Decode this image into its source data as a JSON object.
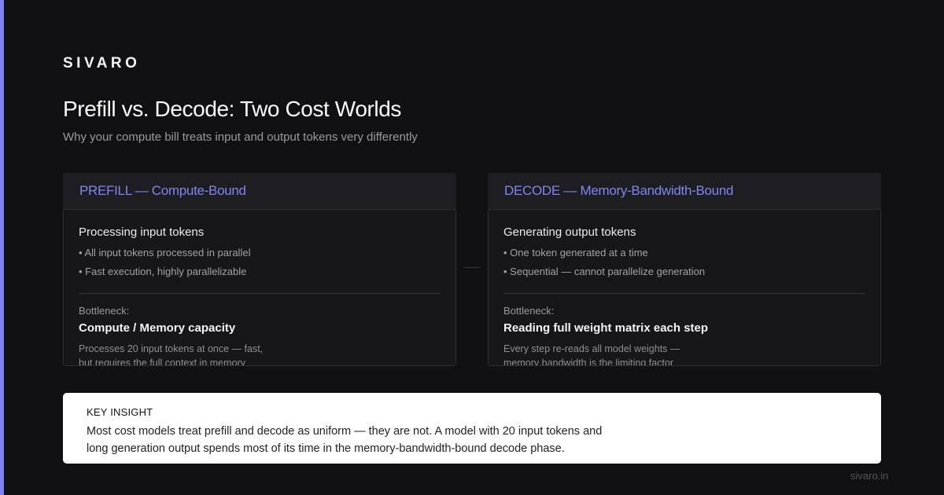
{
  "brand": "SIVARO",
  "header": {
    "title": "Prefill vs. Decode: Two Cost Worlds",
    "subtitle": "Why your compute bill treats input and output tokens very differently"
  },
  "panels": [
    {
      "heading": "PREFILL — Compute-Bound",
      "body_title": "Processing input tokens",
      "bullets": [
        "• All input tokens processed in parallel",
        "• Fast execution, highly parallelizable"
      ],
      "bottleneck_label": "Bottleneck:",
      "bottleneck_value": "Compute / Memory capacity",
      "note_lines": [
        "Processes 20 input tokens at once — fast,",
        "but requires the full context in memory"
      ]
    },
    {
      "heading": "DECODE — Memory-Bandwidth-Bound",
      "body_title": "Generating output tokens",
      "bullets": [
        "• One token generated at a time",
        "• Sequential — cannot parallelize generation"
      ],
      "bottleneck_label": "Bottleneck:",
      "bottleneck_value": "Reading full weight matrix each step",
      "note_lines": [
        "Every step re-reads all model weights —",
        "memory bandwidth is the limiting factor"
      ]
    }
  ],
  "insight": {
    "label": "KEY INSIGHT",
    "text_lines": [
      "Most cost models treat prefill and decode as uniform — they are not. A model with 20 input tokens and",
      "long generation output spends most of its time in the memory-bandwidth-bound decode phase."
    ]
  },
  "footer": {
    "url": "sivaro.in"
  },
  "colors": {
    "background": "#111113",
    "accent": "#7b82f0",
    "panel_heading": "#7f86f2",
    "panel_body": "#17171a",
    "insight_bg": "#ffffff"
  }
}
